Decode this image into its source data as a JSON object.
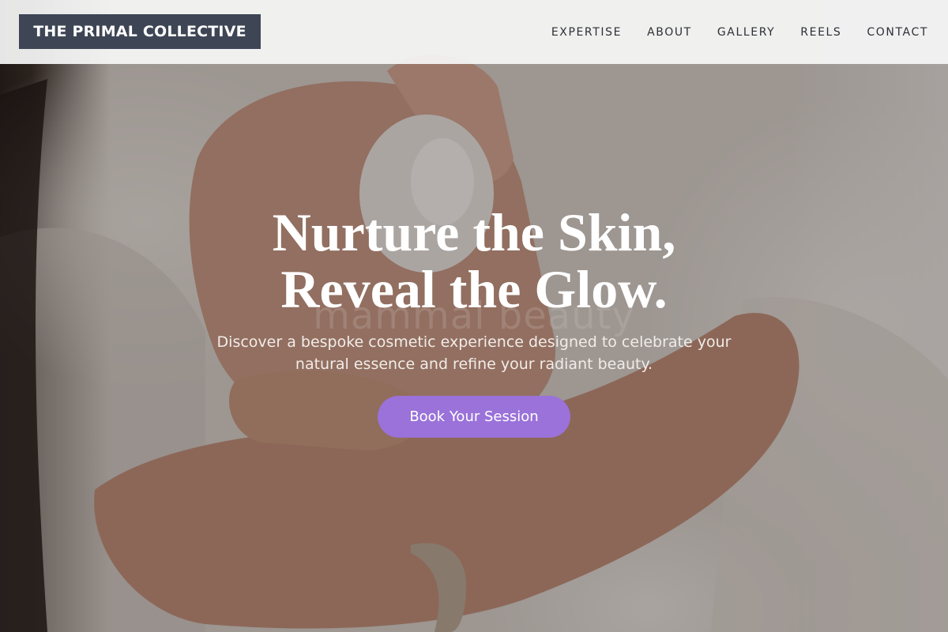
{
  "header": {
    "brand": "THE PRIMAL COLLECTIVE",
    "nav": [
      "EXPERTISE",
      "ABOUT",
      "GALLERY",
      "REELS",
      "CONTACT"
    ]
  },
  "hero": {
    "headline_line1": "Nurture the Skin,",
    "headline_line2": "Reveal the Glow.",
    "watermark": "mammal beauty",
    "subtext": "Discover a bespoke cosmetic experience designed to celebrate your natural essence and refine your radiant beauty.",
    "cta_label": "Book Your Session"
  },
  "colors": {
    "brand_bg": "#3e4655",
    "cta_bg": "#9a72d9",
    "header_bg": "#f6f6f6"
  }
}
